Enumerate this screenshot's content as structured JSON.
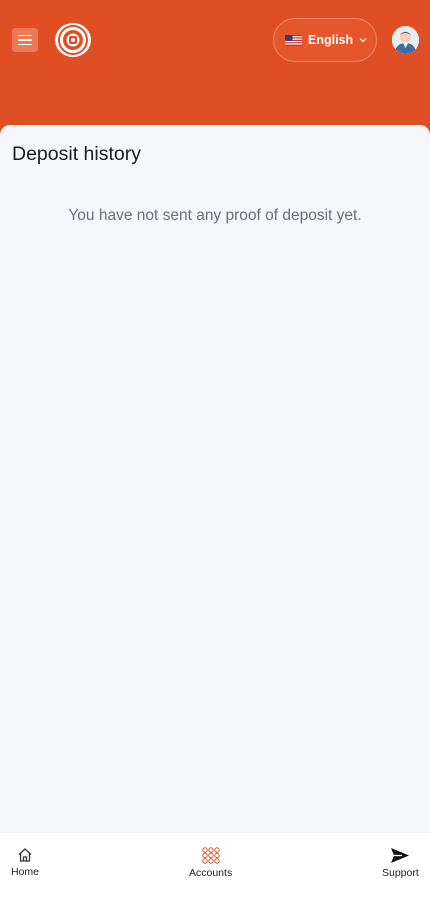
{
  "header": {
    "language": {
      "label": "English",
      "flag": "us-flag-icon"
    }
  },
  "page": {
    "title": "Deposit history",
    "empty_message": "You have not sent any proof of deposit yet."
  },
  "bottom_nav": [
    {
      "label": "Home",
      "icon": "home-icon"
    },
    {
      "label": "Accounts",
      "icon": "grid-icon"
    },
    {
      "label": "Support",
      "icon": "send-icon"
    }
  ],
  "colors": {
    "brand": "#e04f24",
    "background": "#f5f7fa"
  }
}
